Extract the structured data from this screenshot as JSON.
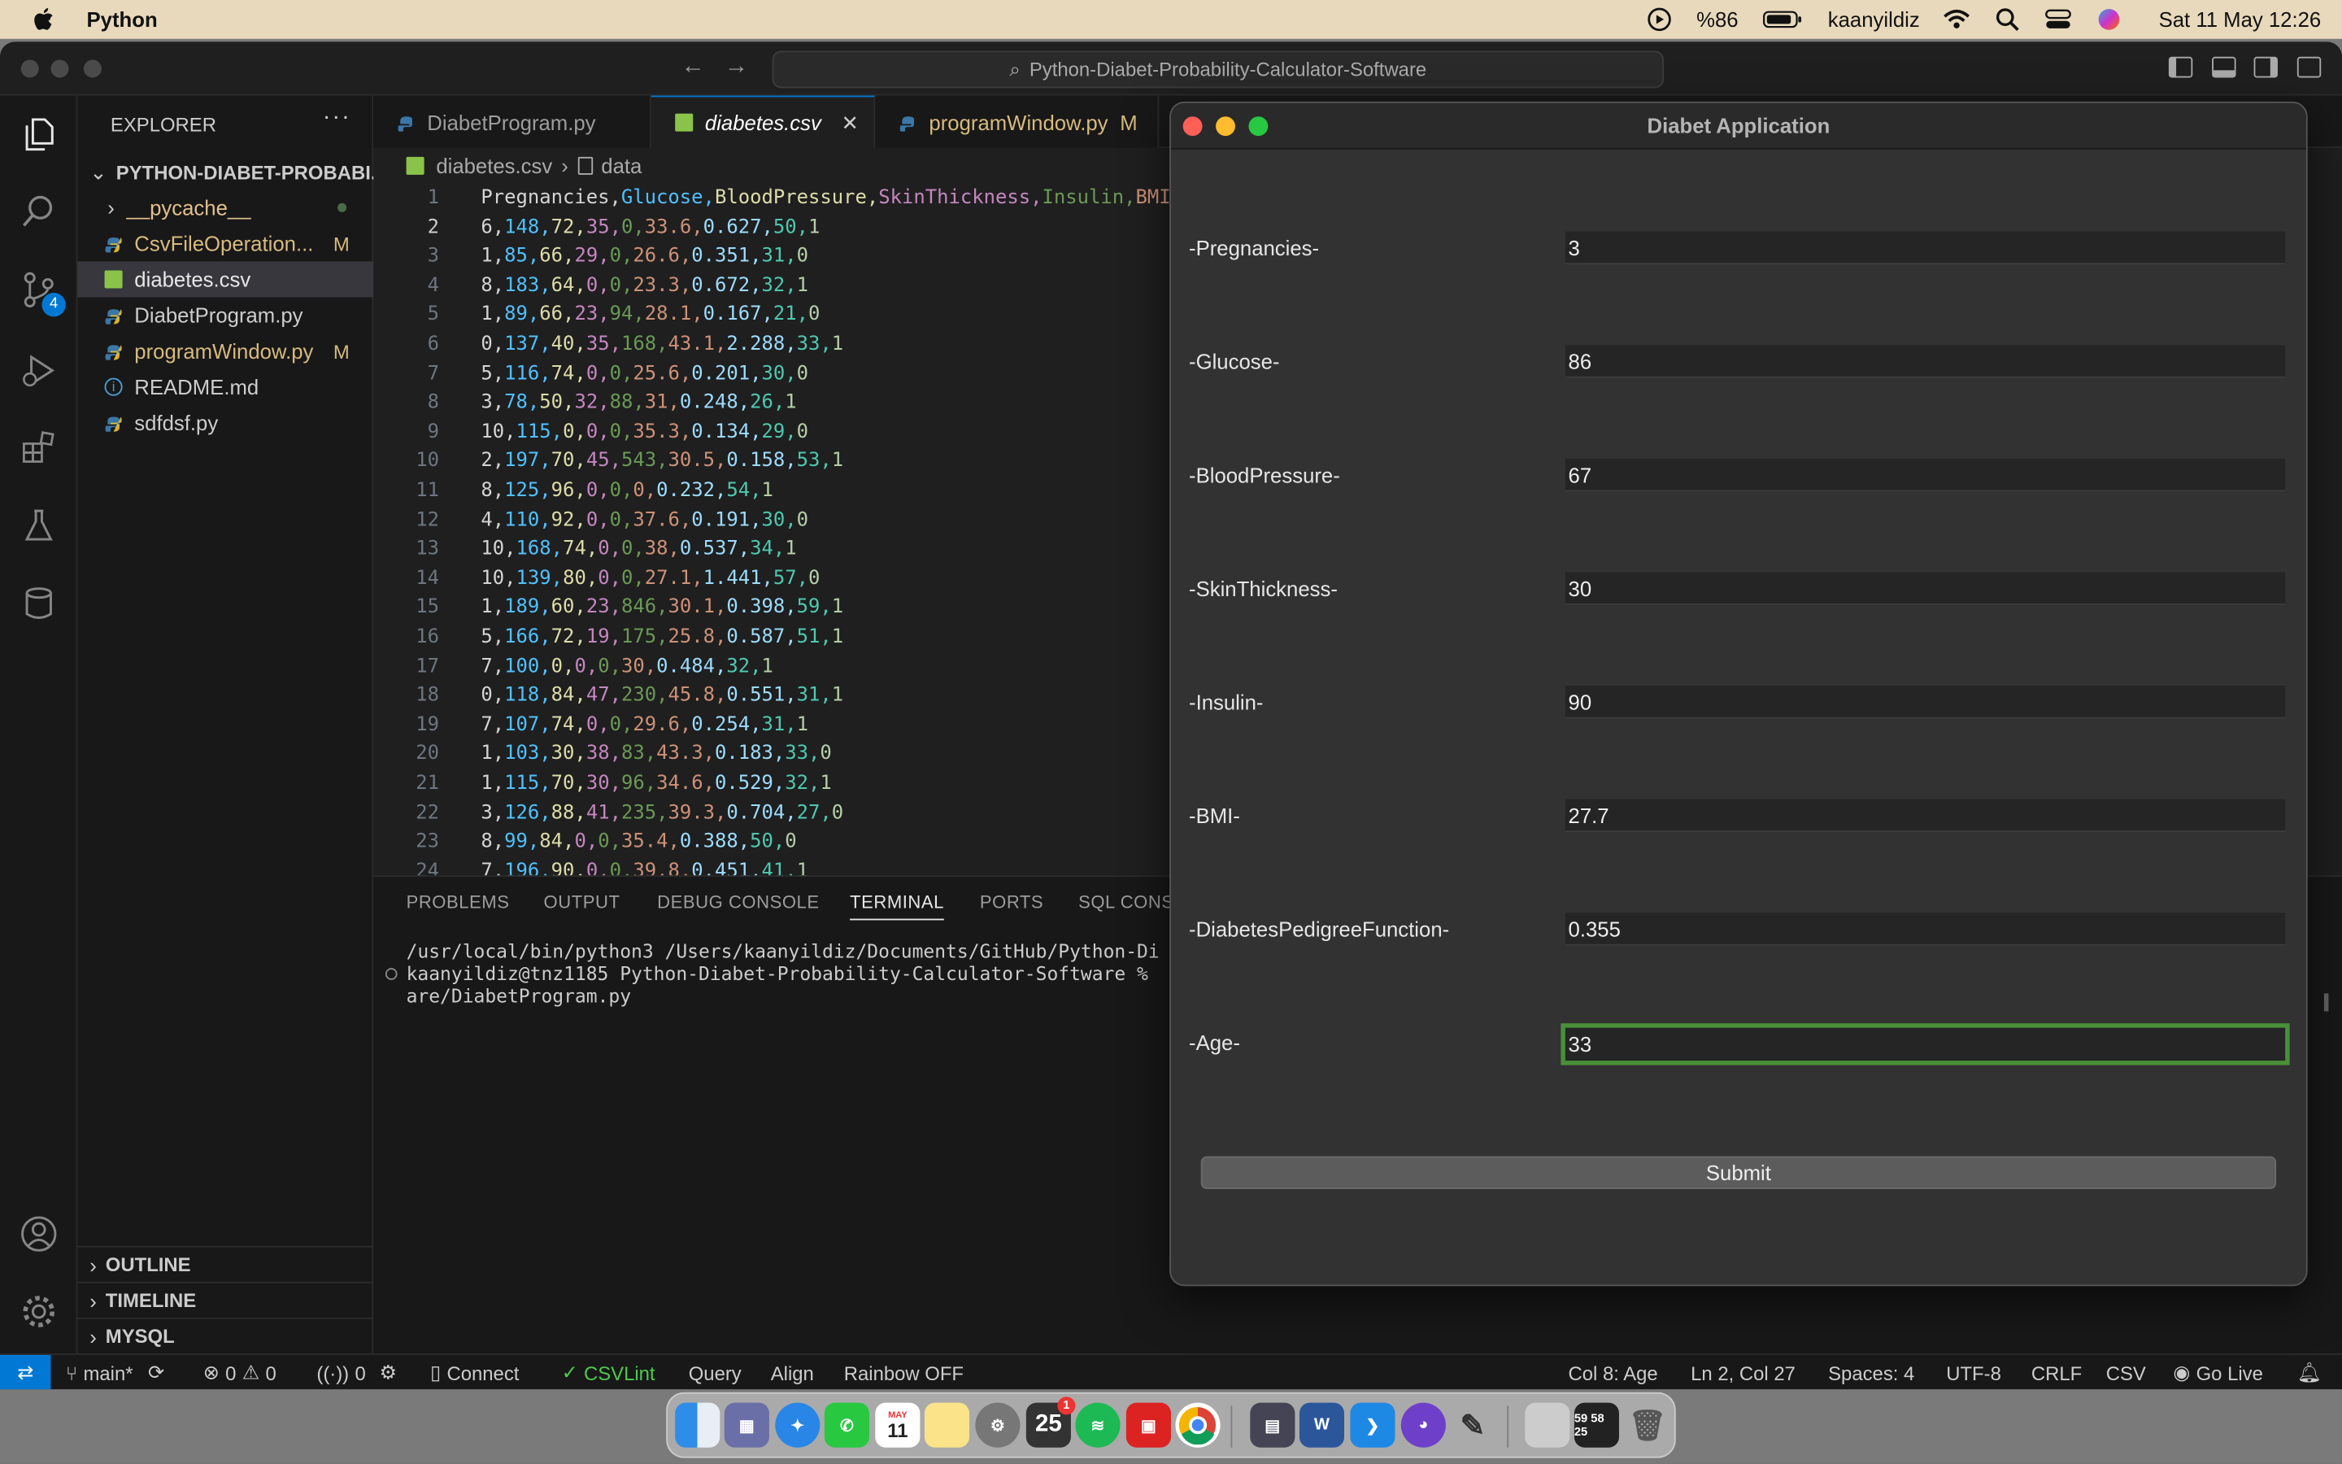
{
  "menubar": {
    "app_name": "Python",
    "battery": "%86",
    "user": "kaanyildiz",
    "datetime": "Sat 11 May  12:26"
  },
  "vscode": {
    "command_center": "Python-Diabet-Probability-Calculator-Software",
    "explorer_title": "EXPLORER",
    "project_folder": "PYTHON-DIABET-PROBABI...",
    "files": [
      {
        "name": "__pycache__",
        "badge": ""
      },
      {
        "name": "CsvFileOperation...",
        "badge": "M"
      },
      {
        "name": "diabetes.csv",
        "badge": ""
      },
      {
        "name": "DiabetProgram.py",
        "badge": ""
      },
      {
        "name": "programWindow.py",
        "badge": "M"
      },
      {
        "name": "README.md",
        "badge": ""
      },
      {
        "name": "sdfdsf.py",
        "badge": ""
      }
    ],
    "source_control_badge": "4",
    "outline_sections": [
      "OUTLINE",
      "TIMELINE",
      "MYSQL"
    ],
    "tabs": [
      {
        "label": "DiabetProgram.py",
        "badge": ""
      },
      {
        "label": "diabetes.csv",
        "badge": ""
      },
      {
        "label": "programWindow.py",
        "badge": "M"
      }
    ],
    "breadcrumb": {
      "file": "diabetes.csv",
      "section": "data"
    },
    "line_numbers": [
      "1",
      "2",
      "3",
      "4",
      "5",
      "6",
      "7",
      "8",
      "9",
      "10",
      "11",
      "12",
      "13",
      "14",
      "15",
      "16",
      "17",
      "18",
      "19",
      "20",
      "21",
      "22",
      "23",
      "24"
    ],
    "code_lines": [
      "Pregnancies,Glucose,BloodPressure,SkinThickness,Insulin,BMI",
      "6,148,72,35,0,33.6,0.627,50,1",
      "1,85,66,29,0,26.6,0.351,31,0",
      "8,183,64,0,0,23.3,0.672,32,1",
      "1,89,66,23,94,28.1,0.167,21,0",
      "0,137,40,35,168,43.1,2.288,33,1",
      "5,116,74,0,0,25.6,0.201,30,0",
      "3,78,50,32,88,31,0.248,26,1",
      "10,115,0,0,0,35.3,0.134,29,0",
      "2,197,70,45,543,30.5,0.158,53,1",
      "8,125,96,0,0,0,0.232,54,1",
      "4,110,92,0,0,37.6,0.191,30,0",
      "10,168,74,0,0,38,0.537,34,1",
      "10,139,80,0,0,27.1,1.441,57,0",
      "1,189,60,23,846,30.1,0.398,59,1",
      "5,166,72,19,175,25.8,0.587,51,1",
      "7,100,0,0,0,30,0.484,32,1",
      "0,118,84,47,230,45.8,0.551,31,1",
      "7,107,74,0,0,29.6,0.254,31,1",
      "1,103,30,38,83,43.3,0.183,33,0",
      "1,115,70,30,96,34.6,0.529,32,1",
      "3,126,88,41,235,39.3,0.704,27,0",
      "8,99,84,0,0,35.4,0.388,50,0",
      "7,196,90,0,0,39.8,0.451,41,1"
    ],
    "panel_tabs": [
      "PROBLEMS",
      "OUTPUT",
      "DEBUG CONSOLE",
      "TERMINAL",
      "PORTS",
      "SQL CONS"
    ],
    "terminal_lines": [
      "/usr/local/bin/python3 /Users/kaanyildiz/Documents/GitHub/Python-Di",
      "kaanyildiz@tnz1185 Python-Diabet-Probability-Calculator-Software % ",
      "are/DiabetProgram.py"
    ],
    "status": {
      "branch": "main*",
      "errors": "0",
      "warnings": "0",
      "ports": "0",
      "connect": "Connect",
      "csvlint": "CSVLint",
      "query": "Query",
      "align": "Align",
      "rainbow": "Rainbow OFF",
      "col": "Col 8: Age",
      "position": "Ln 2, Col 27",
      "spaces": "Spaces: 4",
      "encoding": "UTF-8",
      "eol": "CRLF",
      "language": "CSV",
      "golive": "Go Live"
    }
  },
  "app": {
    "title": "Diabet Application",
    "fields": [
      {
        "label": "-Pregnancies-",
        "value": "3"
      },
      {
        "label": "-Glucose-",
        "value": "86"
      },
      {
        "label": "-BloodPressure-",
        "value": "67"
      },
      {
        "label": "-SkinThickness-",
        "value": "30"
      },
      {
        "label": "-Insulin-",
        "value": "90"
      },
      {
        "label": "-BMI-",
        "value": "27.7"
      },
      {
        "label": "-DiabetesPedigreeFunction-",
        "value": "0.355"
      },
      {
        "label": "-Age-",
        "value": "33"
      }
    ],
    "submit_label": "Submit"
  },
  "dock": {
    "calendar_month": "MAY",
    "calendar_day": "11",
    "notification_count": "1",
    "date_widget": "25",
    "clock_widget": "59 58 25"
  },
  "colors": {
    "accent": "#0078d4",
    "focus_ring": "#4a8f3a",
    "menubar": "#e9d9bc",
    "modified": "#d7ba7d"
  }
}
